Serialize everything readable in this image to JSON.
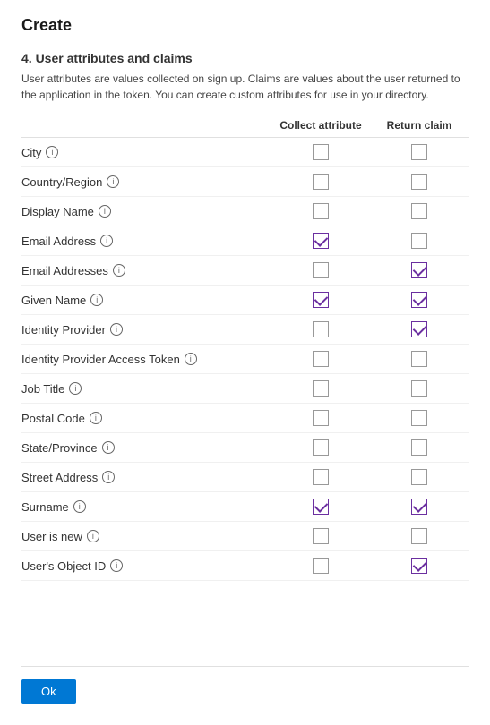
{
  "page": {
    "title": "Create",
    "section_number": "4. User attributes and claims",
    "description": "User attributes are values collected on sign up. Claims are values about the user returned to the application in the token. You can create custom attributes for use in your directory.",
    "table": {
      "col_collect": "Collect attribute",
      "col_return": "Return claim",
      "rows": [
        {
          "name": "City",
          "collect": false,
          "return": false
        },
        {
          "name": "Country/Region",
          "collect": false,
          "return": false
        },
        {
          "name": "Display Name",
          "collect": false,
          "return": false
        },
        {
          "name": "Email Address",
          "collect": true,
          "return": false
        },
        {
          "name": "Email Addresses",
          "collect": false,
          "return": true
        },
        {
          "name": "Given Name",
          "collect": true,
          "return": true
        },
        {
          "name": "Identity Provider",
          "collect": false,
          "return": true
        },
        {
          "name": "Identity Provider Access Token",
          "collect": false,
          "return": false
        },
        {
          "name": "Job Title",
          "collect": false,
          "return": false
        },
        {
          "name": "Postal Code",
          "collect": false,
          "return": false
        },
        {
          "name": "State/Province",
          "collect": false,
          "return": false
        },
        {
          "name": "Street Address",
          "collect": false,
          "return": false
        },
        {
          "name": "Surname",
          "collect": true,
          "return": true
        },
        {
          "name": "User is new",
          "collect": false,
          "return": false
        },
        {
          "name": "User's Object ID",
          "collect": false,
          "return": true
        }
      ]
    },
    "ok_button_label": "Ok"
  }
}
